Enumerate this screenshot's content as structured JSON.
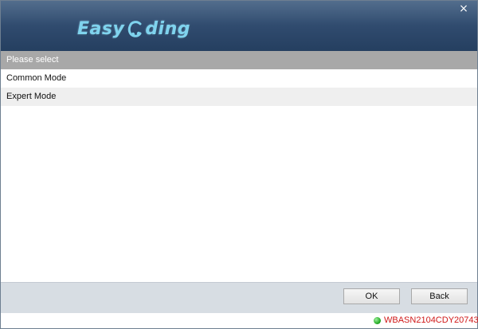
{
  "header": {
    "logo_text_1": "Easy",
    "logo_text_2": "ding",
    "logo_icon": "car-icon",
    "close_label": "×"
  },
  "list": {
    "header_label": "Please select",
    "items": [
      {
        "label": "Common Mode"
      },
      {
        "label": "Expert Mode"
      }
    ]
  },
  "footer": {
    "ok_label": "OK",
    "back_label": "Back"
  },
  "status": {
    "connection_icon": "status-dot-icon",
    "vin": "WBASN2104CDY20743",
    "vin_color": "#d01818",
    "connected_color": "#19a319"
  },
  "colors": {
    "header_bg": "#2f4a6d",
    "logo": "#7fd3ee",
    "list_header_bg": "#a8a8a8",
    "footer_bg": "#d7dde3"
  }
}
